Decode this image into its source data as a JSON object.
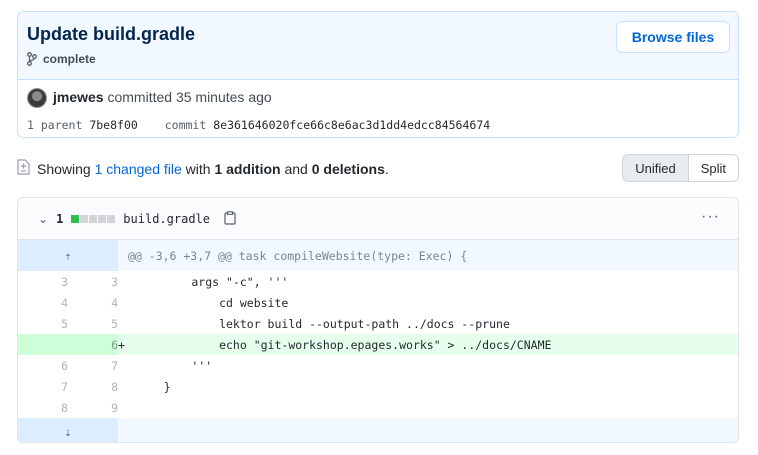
{
  "commit": {
    "title": "Update build.gradle",
    "branch": "complete",
    "browse_label": "Browse files",
    "author": "jmewes",
    "action": "committed 35 minutes ago",
    "parent_label": "1 parent",
    "parent_sha": "7be8f00",
    "commit_label": "commit",
    "commit_sha": "8e361646020fce66c8e6ac3d1dd4edcc84564674"
  },
  "toc": {
    "showing": "Showing",
    "changed_files": "1 changed file",
    "with": "with",
    "additions": "1 addition",
    "and": "and",
    "deletions": "0 deletions",
    "period": "."
  },
  "view_toggle": {
    "unified": "Unified",
    "split": "Split"
  },
  "file": {
    "change_count": "1",
    "diffstat": {
      "added": 1,
      "neutral": 4
    },
    "name": "build.gradle",
    "kebab": "···",
    "hunk_header": "@@ -3,6 +3,7 @@ task compileWebsite(type: Exec) {",
    "expand_up": "⇡",
    "expand_down": "⇣",
    "lines": [
      {
        "old": "3",
        "new": "3",
        "sign": "",
        "code": "        args \"-c\", '''",
        "type": "context"
      },
      {
        "old": "4",
        "new": "4",
        "sign": "",
        "code": "            cd website",
        "type": "context"
      },
      {
        "old": "5",
        "new": "5",
        "sign": "",
        "code": "            lektor build --output-path ../docs --prune",
        "type": "context"
      },
      {
        "old": "",
        "new": "6",
        "sign": "+",
        "code": "            echo \"git-workshop.epages.works\" > ../docs/CNAME",
        "type": "add"
      },
      {
        "old": "6",
        "new": "7",
        "sign": "",
        "code": "        '''",
        "type": "context"
      },
      {
        "old": "7",
        "new": "8",
        "sign": "",
        "code": "    }",
        "type": "context"
      },
      {
        "old": "8",
        "new": "9",
        "sign": "",
        "code": "",
        "type": "context"
      }
    ]
  },
  "colors": {
    "link": "#0366d6",
    "add_bg": "#e6ffed",
    "add_num_bg": "#cdffd8",
    "hunk_bg": "#f1f8ff"
  }
}
